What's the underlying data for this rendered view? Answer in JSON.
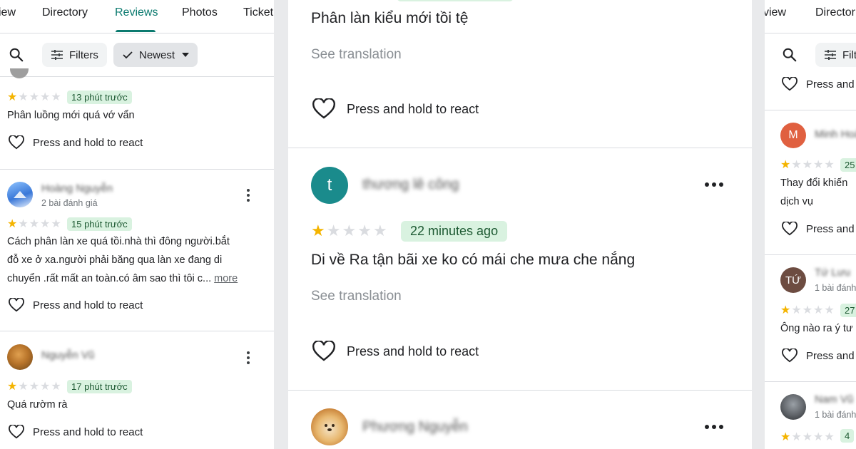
{
  "left": {
    "tabs": [
      "iew",
      "Directory",
      "Reviews",
      "Photos",
      "Ticket"
    ],
    "filters_label": "Filters",
    "newest_label": "Newest",
    "react_label": "Press and hold to react",
    "reviews": [
      {
        "time": "13 phút trước",
        "text": [
          "Phân luồng mới quá vớ vẩn"
        ],
        "rating": 1
      },
      {
        "name": "Hoàng Nguyễn",
        "sub": "2 bài đánh giá",
        "time": "15 phút trước",
        "rating": 1,
        "text": [
          "Cách phân làn xe quá tồi.nhà thì đông người.bắt",
          "đỗ xe ở xa.người phải băng qua làn xe đang di",
          "chuyển .rất mất an toàn.có âm sao thì tôi c..."
        ],
        "more": "more"
      },
      {
        "name": "Nguyễn Vũ",
        "time": "17 phút trước",
        "text": [
          "Quá rườm rà"
        ],
        "rating": 1
      }
    ]
  },
  "mid": {
    "top_text": "Phân làn kiểu mới tồi tệ",
    "see_translation": "See translation",
    "react_label": "Press and hold to react",
    "review": {
      "avatar_letter": "t",
      "name": "thương lê công",
      "time": "22 minutes ago",
      "text": "Di về Ra tận bãi xe ko có mái che mưa che nắng",
      "rating": 1
    },
    "next_name": "Phương Nguyễn"
  },
  "right": {
    "tabs": [
      "view",
      "Director"
    ],
    "filters_label": "Filte",
    "react_label": "Press and",
    "items": [
      {
        "avatar_letter": "M",
        "name": "Minh Hoàng",
        "badge": "25",
        "text": [
          "Thay đổi khiến",
          "dịch vụ"
        ]
      },
      {
        "avatar_letter": "TỨ",
        "name": "Tứ Lưu",
        "sub": "1 bài đánh",
        "badge": "27",
        "text": [
          "Ông nào ra ý tư"
        ]
      },
      {
        "name": "Nam Vũ",
        "sub": "1 bài đánh",
        "badge": "4"
      }
    ]
  },
  "colors": {
    "accent": "#0b7a6f",
    "star": "#f4b400",
    "badge_bg": "#d9f2e0",
    "avatar_t": "#1a8b8c",
    "avatar_m": "#e06040",
    "avatar_tu": "#6d4c41"
  },
  "icons": [
    "search-icon",
    "filter-icon",
    "check-icon",
    "caret-down-icon",
    "heart-icon",
    "more-vert-icon",
    "more-horiz-icon",
    "star-icon"
  ]
}
